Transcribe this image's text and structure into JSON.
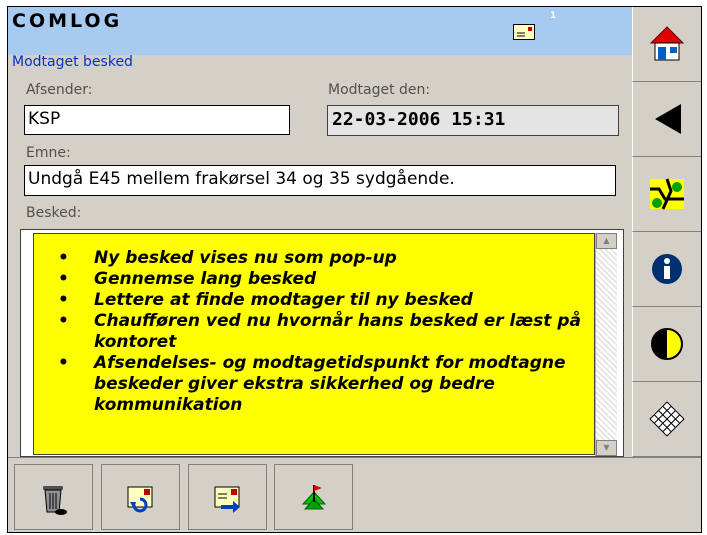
{
  "header": {
    "app_title": "COMLOG",
    "message_count": "1"
  },
  "screen_title": "Modtaget besked",
  "fields": {
    "sender_label": "Afsender:",
    "sender_value": "KSP",
    "received_label": "Modtaget den:",
    "received_value": "22-03-2006 15:31",
    "subject_label": "Emne:",
    "subject_value": "Undgå E45 mellem frakørsel 34 og 35 sydgående.",
    "message_label": "Besked:"
  },
  "popup": {
    "items": [
      "Ny besked vises nu som pop-up",
      "Gennemse lang besked",
      "Lettere at finde modtager til ny besked",
      "Chaufføren ved nu hvornår hans besked er læst på kontoret",
      "Afsendelses- og modtagetidspunkt for modtagne beskeder giver ekstra sikkerhed og bedre kommunikation"
    ]
  },
  "right_panel": {
    "icons": [
      "home-icon",
      "back-arrow-icon",
      "map-icon",
      "info-icon",
      "contrast-icon",
      "grid-icon"
    ]
  },
  "bottom_bar": {
    "icons": [
      "trash-icon",
      "reply-message-icon",
      "forward-message-icon",
      "recipient-flag-icon"
    ]
  },
  "colors": {
    "header_bg": "#a6caf0",
    "screen_title": "#0033cc",
    "popup_bg": "#ffff00",
    "panel_bg": "#d4d0c8"
  }
}
